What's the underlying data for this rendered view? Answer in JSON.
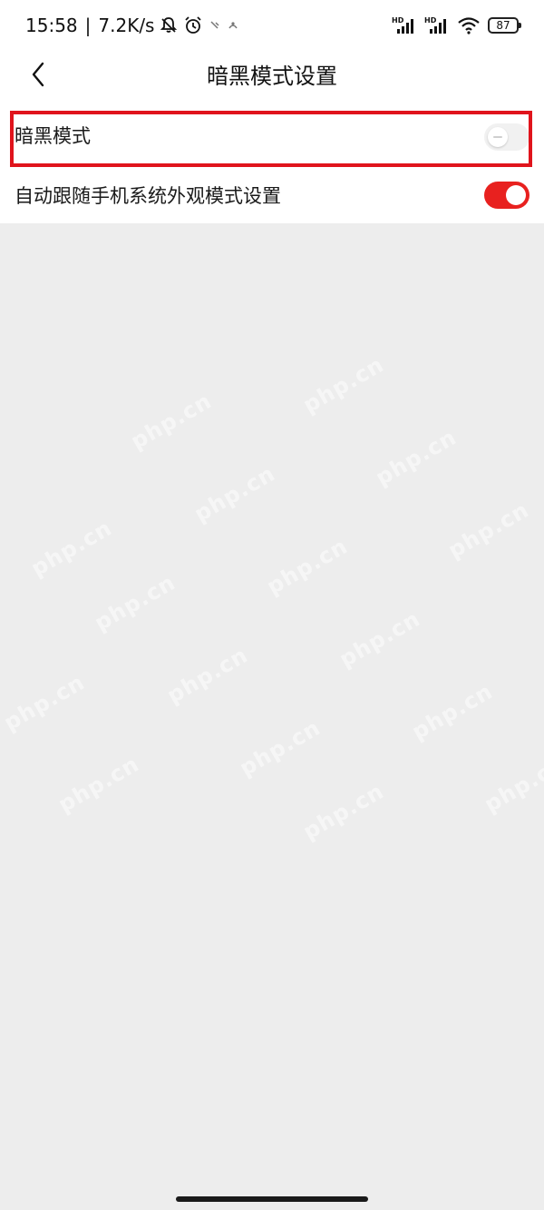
{
  "status_bar": {
    "time": "15:58",
    "separator": "|",
    "net_speed": "7.2K/s",
    "battery_level": "87",
    "icons_left": [
      "bell-off-icon",
      "alarm-icon",
      "notification-icon",
      "notification-icon"
    ],
    "icons_right": [
      "hd-signal-icon",
      "hd-signal-icon",
      "wifi-icon",
      "battery-icon"
    ]
  },
  "navbar": {
    "back_icon": "chevron-left-icon",
    "title": "暗黑模式设置"
  },
  "settings": {
    "items": [
      {
        "label": "暗黑模式",
        "enabled": false,
        "highlighted": true
      },
      {
        "label": "自动跟随手机系统外观模式设置",
        "enabled": true,
        "highlighted": false
      }
    ]
  },
  "watermark": "php.cn",
  "colors": {
    "accent": "#e8211f",
    "highlight_border": "#e0141c",
    "page_background": "#ededed",
    "surface": "#ffffff"
  }
}
